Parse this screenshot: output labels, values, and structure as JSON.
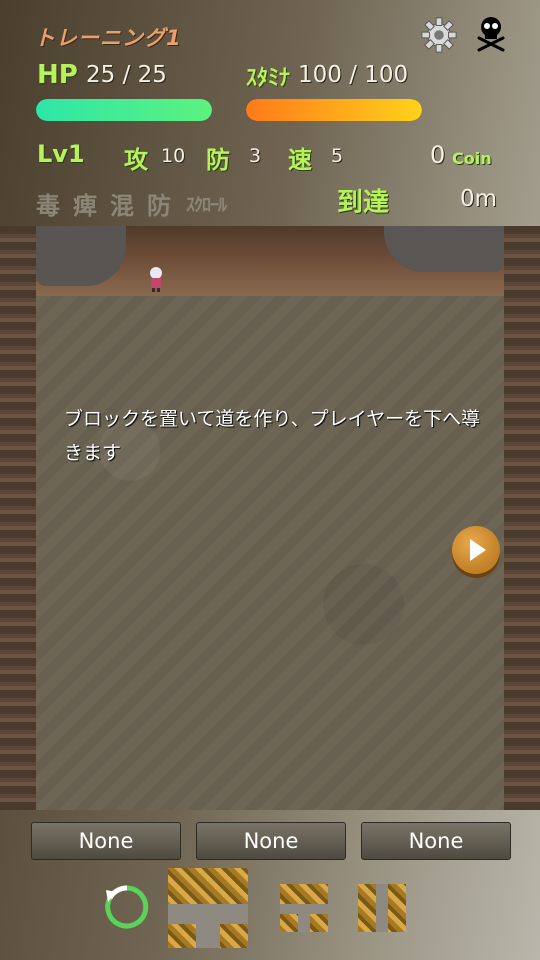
{
  "header": {
    "stage_title": "トレーニング1",
    "settings_icon": "gear-icon",
    "giveup_icon": "skull-icon"
  },
  "stats": {
    "hp_label": "HP",
    "hp_value": "25 / 25",
    "hp_fraction": 1.0,
    "stamina_label": "ｽﾀﾐﾅ",
    "stamina_value": "100 / 100",
    "stamina_fraction": 1.0,
    "level_label": "Lv",
    "level_value": "1",
    "attack_label": "攻",
    "attack_value": "10",
    "defense_label": "防",
    "defense_value": "3",
    "speed_label": "速",
    "speed_value": "5",
    "coin_value": "0",
    "coin_label": "Coin"
  },
  "status_effects": [
    "毒",
    "痺",
    "混",
    "防",
    "ｽｸﾛｰﾙ"
  ],
  "reach": {
    "label": "到達",
    "value": "0m"
  },
  "field": {
    "tutorial_text": "ブロックを置いて道を作り、プレイヤーを下へ導きます",
    "play_icon": "play-icon"
  },
  "slots": [
    "None",
    "None",
    "None"
  ],
  "colors": {
    "hp_bar": "#3ce8a0",
    "stamina_bar": "#ff9a1c",
    "label_green": "#b6f25a",
    "title_orange": "#e8a06e"
  }
}
